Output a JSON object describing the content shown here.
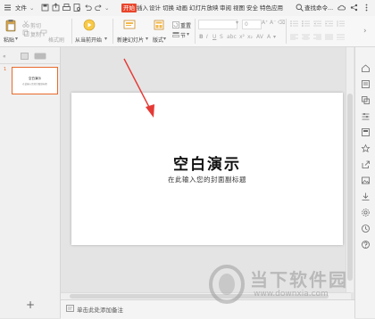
{
  "menubar": {
    "file": "文件",
    "tabs": [
      "开始",
      "插入",
      "设计",
      "切换",
      "动画",
      "幻灯片放映",
      "审阅",
      "视图",
      "安全",
      "特色应用"
    ],
    "active_tab": "开始",
    "search": "查找命令..."
  },
  "ribbon": {
    "paste": "粘贴",
    "cut": "剪切",
    "copy": "复制",
    "format_painter": "格式刷",
    "from_current": "从当前开始",
    "new_slide": "新建幻灯片",
    "layout": "版式",
    "reset": "重置",
    "section": "节",
    "font_size": "0"
  },
  "slide": {
    "number": "1",
    "title": "空白演示",
    "subtitle": "在此输入您的封面副标题"
  },
  "notes": {
    "placeholder": "单击此处添加备注"
  },
  "watermark": {
    "name": "当下软件园",
    "url": "www.downxia.com"
  },
  "colors": {
    "accent": "#e8452c",
    "arrow": "#e53935"
  }
}
